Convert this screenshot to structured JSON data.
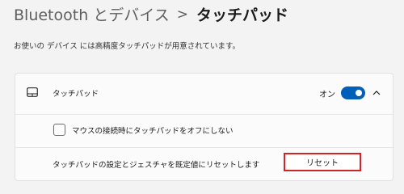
{
  "header": {
    "parent": "Bluetooth とデバイス",
    "separator": ">",
    "current": "タッチパッド"
  },
  "description": "お使いの デバイス には高精度タッチパッドが用意されています。",
  "touchpad_section": {
    "icon": "touchpad-icon",
    "label": "タッチパッド",
    "toggle_state_label": "オン",
    "toggle_on": true,
    "accent_color": "#005fb8",
    "expanded": true
  },
  "mouse_option": {
    "label": "マウスの接続時にタッチパッドをオフにしない",
    "checked": false
  },
  "reset_option": {
    "label": "タッチパッドの設定とジェスチャを既定値にリセットします",
    "button_label": "リセット",
    "highlight_color": "#d2232a"
  }
}
